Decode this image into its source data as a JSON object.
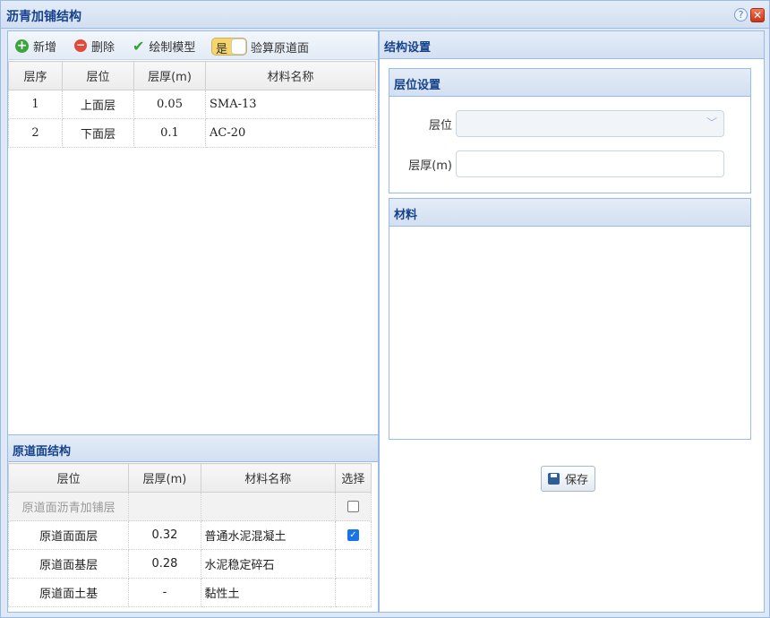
{
  "window": {
    "title": "沥青加铺结构"
  },
  "toolbar": {
    "add_label": "新增",
    "delete_label": "删除",
    "draw_label": "绘制模型",
    "switch_on_label": "是",
    "switch_label": "验算原道面"
  },
  "layer_table": {
    "columns": [
      "层序",
      "层位",
      "层厚(m)",
      "材料名称"
    ],
    "rows": [
      [
        "1",
        "上面层",
        "0.05",
        "SMA-13"
      ],
      [
        "2",
        "下面层",
        "0.1",
        "AC-20"
      ]
    ]
  },
  "original": {
    "title": "原道面结构",
    "columns": [
      "层位",
      "层厚(m)",
      "材料名称",
      "选择"
    ],
    "rows": [
      [
        "原道面沥青加铺层",
        "",
        "",
        ""
      ],
      [
        "原道面面层",
        "0.32",
        "普通水泥混凝土",
        ""
      ],
      [
        "原道面基层",
        "0.28",
        "水泥稳定碎石",
        ""
      ],
      [
        "原道面土基",
        "-",
        "黏性土",
        ""
      ]
    ]
  },
  "structure": {
    "title": "结构设置",
    "layer_settings": {
      "title": "层位设置",
      "layer_label": "层位",
      "layer_value": "",
      "thickness_label": "层厚(m)",
      "thickness_value": ""
    },
    "material": {
      "title": "材料"
    },
    "save_label": "保存"
  },
  "colors": {
    "header_text": "#15428b",
    "border": "#99bbe8",
    "accent": "#dfe8f6"
  }
}
